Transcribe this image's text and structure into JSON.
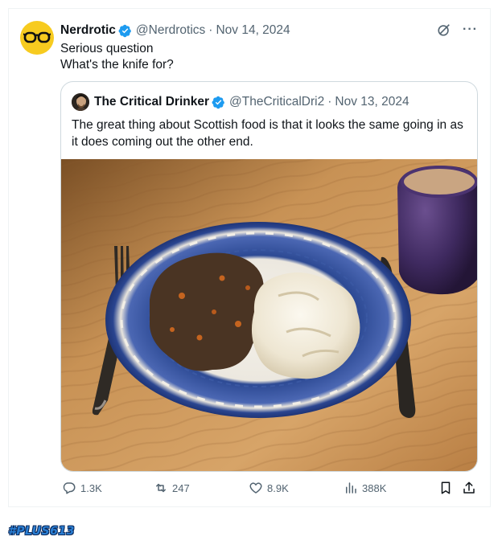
{
  "post": {
    "author_name": "Nerdrotic",
    "author_handle": "@Nerdrotics",
    "separator": "·",
    "date": "Nov 14, 2024",
    "text_lines": [
      "Serious question",
      "What's the knife for?"
    ]
  },
  "quoted_post": {
    "author_name": "The Critical Drinker",
    "author_handle": "@TheCriticalDri2",
    "separator": "·",
    "date": "Nov 13, 2024",
    "text": "The great thing about Scottish food is that it looks the same going in as it does coming out the other end.",
    "image_icon": "food-photo-plate-mince-tatties"
  },
  "actions": {
    "replies": "1.3K",
    "reposts": "247",
    "likes": "8.9K",
    "views": "388K"
  },
  "watermark": {
    "text": "#PLUS613"
  },
  "colors": {
    "verified": "#1d9bf0",
    "muted": "#536471",
    "border": "#cfd9de",
    "avatar_bg": "#f7cb1f"
  },
  "icons": {
    "verified": "verified-badge-icon",
    "grok": "grok-icon",
    "more": "more-icon",
    "reply": "reply-icon",
    "repost": "repost-icon",
    "like": "heart-icon",
    "views": "views-icon",
    "bookmark": "bookmark-icon",
    "share": "share-icon"
  }
}
